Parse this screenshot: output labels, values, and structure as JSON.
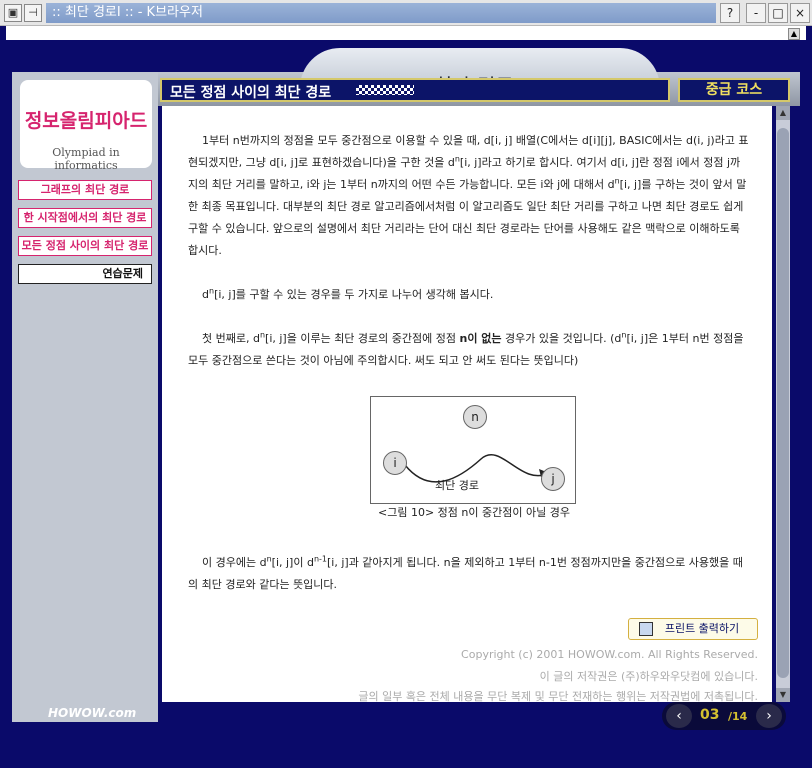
{
  "window": {
    "title": ":: 최단 경로I :: - K브라우저",
    "help": "?",
    "minimize": "-",
    "maximize": "□",
    "close": "×"
  },
  "header": {
    "banner_title": "최단 경로 I",
    "section_title": "모든 정점 사이의 최단 경로",
    "course": "중급 코스"
  },
  "sidebar": {
    "logo_kr": "정보올림피아드",
    "logo_en": "Olympiad in informatics",
    "items": [
      {
        "label": "그래프의 최단 경로"
      },
      {
        "label": "한 시작점에서의 최단 경로"
      },
      {
        "label": "모든 정점 사이의 최단 경로"
      },
      {
        "label": "연습문제"
      }
    ]
  },
  "content": {
    "p1": "1부터 n번까지의 정점을 모두 중간점으로 이용할 수 있을 때, d[i, j] 배열(C에서는 d[i][j], BASIC에서는 d(i, j)라고 표현되겠지만, 그냥 d[i, j]로 표현하겠습니다)을 구한 것을 d",
    "p1_sup": "n",
    "p1_b": "[i, j]라고 하기로 합시다. 여기서 d[i, j]란 정점 i에서 정점 j까지의 최단 거리를 말하고, i와 j는 1부터 n까지의 어떤 수든 가능합니다. 모든 i와 j에 대해서 d",
    "p1_sup2": "n",
    "p1_c": "[i, j]를 구하는 것이 앞서 말한 최종 목표입니다. 대부분의 최단 경로 알고리즘에서처럼 이 알고리즘도 일단 최단 거리를 구하고 나면 최단 경로도 쉽게 구할 수 있습니다. 앞으로의 설명에서 최단 거리라는 단어 대신 최단 경로라는 단어를 사용해도 같은 맥락으로 이해하도록 합시다.",
    "p2_a": "d",
    "p2_sup": "n",
    "p2_b": "[i, j]를 구할 수 있는 경우를 두 가지로 나누어 생각해 봅시다.",
    "p3_a": "첫 번째로, d",
    "p3_sup": "n",
    "p3_b": "[i, j]을 이루는 최단 경로의 중간점에 정점 ",
    "p3_bold": "n이 없는",
    "p3_c": " 경우가 있을 것입니다. (d",
    "p3_sup2": "n",
    "p3_d": "[i, j]은 1부터 n번 정점을 모두 중간점으로 쓴다는 것이 아님에 주의합시다. 써도 되고 안 써도 된다는 뜻입니다)",
    "p4_a": "이 경우에는 d",
    "p4_sup": "n",
    "p4_b": "[i, j]이 d",
    "p4_sup2": "n-1",
    "p4_c": "[i, j]과 같아지게 됩니다. n을 제외하고 1부터 n-1번 정점까지만을 중간점으로 사용했을 때의 최단 경로와 같다는 뜻입니다."
  },
  "figure": {
    "node_n": "n",
    "node_i": "i",
    "node_j": "j",
    "path_label": "최단 경로",
    "caption": "<그림 10> 정점 n이 중간점이 아닐 경우"
  },
  "print_button": "프린트 출력하기",
  "copyright": {
    "line1": "Copyright (c) 2001 HOWOW.com. All Rights Reserved.",
    "line2": "이 글의 저작권은 (주)하우와우닷컴에 있습니다.",
    "line3": "글의 일부 혹은 전체 내용을 무단 복제 및 무단 전재하는 행위는 저작권법에 저촉됩니다."
  },
  "footer": {
    "logo": "HOWOW.com",
    "page_current": "03",
    "page_total": "/14",
    "prev": "‹",
    "next": "›"
  }
}
